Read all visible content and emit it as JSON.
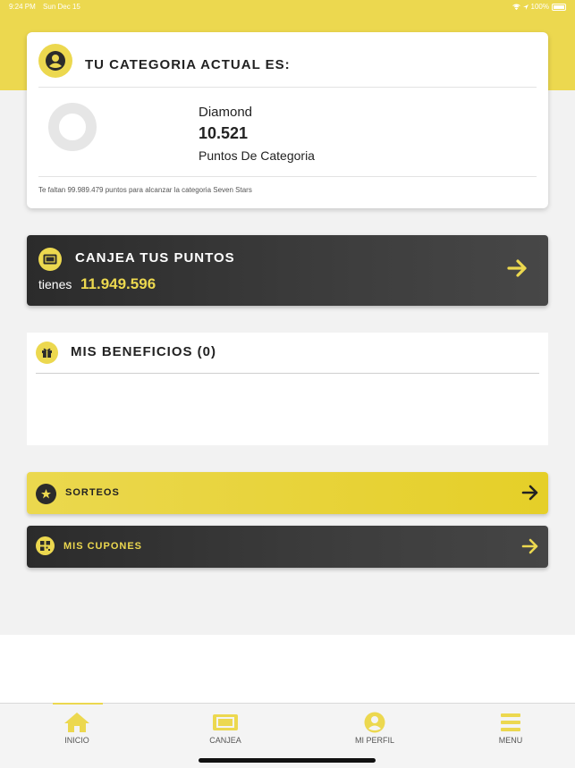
{
  "status_bar": {
    "time": "9:24 PM",
    "date": "Sun Dec 15",
    "battery": "100%"
  },
  "category_card": {
    "title": "TU CATEGORIA ACTUAL ES:",
    "category_name": "Diamond",
    "points": "10.521",
    "points_label": "Puntos De Categoria",
    "footer_text": "Te faltan 99.989.479 puntos para alcanzar la categoria Seven Stars",
    "avatar_icon": "user-icon"
  },
  "canjea_card": {
    "title": "CANJEA TUS PUNTOS",
    "tienes_label": "tienes",
    "tienes_value": "11.949.596",
    "icon": "ticket-icon"
  },
  "benefits_card": {
    "title": "MIS BENEFICIOS (0)",
    "icon": "gift-icon"
  },
  "actions": {
    "sorteos": "SORTEOS",
    "cupones": "MIS CUPONES"
  },
  "tab_bar": {
    "items": [
      {
        "label": "INICIO",
        "icon": "home-icon",
        "active": true
      },
      {
        "label": "CANJEA",
        "icon": "ticket-icon",
        "active": false
      },
      {
        "label": "MI PERFIL",
        "icon": "user-icon",
        "active": false
      },
      {
        "label": "MENU",
        "icon": "menu-icon",
        "active": false
      }
    ]
  },
  "colors": {
    "accent": "#ecd84f",
    "dark": "#2b2b2b",
    "background": "#f2f2f2"
  }
}
